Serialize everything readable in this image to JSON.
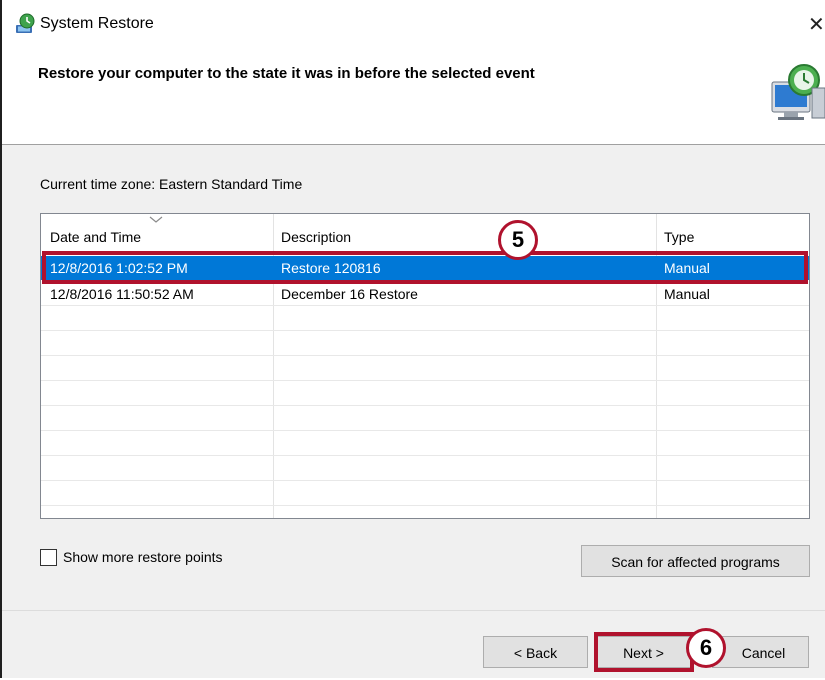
{
  "window": {
    "title": "System Restore",
    "close_glyph": "✕",
    "header_text": "Restore your computer to the state it was in before the selected event"
  },
  "timezone_label": "Current time zone: Eastern Standard Time",
  "list": {
    "columns": [
      "Date and Time",
      "Description",
      "Type"
    ],
    "rows": [
      {
        "date": "12/8/2016 1:02:52 PM",
        "description": "Restore 120816",
        "type": "Manual",
        "selected": true
      },
      {
        "date": "12/8/2016 11:50:52 AM",
        "description": "December 16 Restore",
        "type": "Manual",
        "selected": false
      }
    ]
  },
  "show_more": {
    "label": "Show more restore points",
    "checked": false
  },
  "buttons": {
    "scan": "Scan for affected programs",
    "back": "< Back",
    "next": "Next >",
    "cancel": "Cancel"
  },
  "callouts": {
    "step5": "5",
    "step6": "6"
  },
  "colors": {
    "selection": "#0078d7",
    "highlight": "#b0122d"
  }
}
